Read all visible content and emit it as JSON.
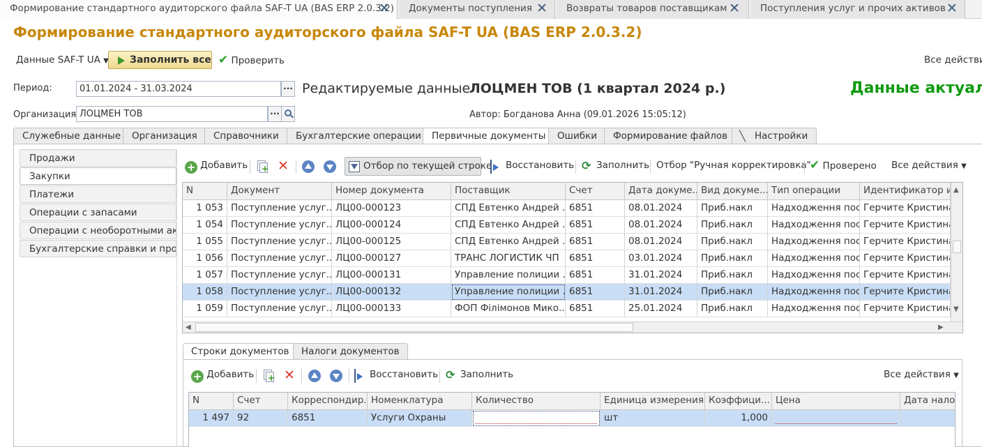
{
  "window_tabs": [
    {
      "label": "Формирование стандартного аудиторского файла SAF-T UA (BAS ERP 2.0.3.2)",
      "close": "✕"
    },
    {
      "label": "Документы поступления",
      "close": "✕"
    },
    {
      "label": "Возвраты товаров поставщикам",
      "close": "✕"
    },
    {
      "label": "Поступления услуг и прочих активов",
      "close": "✕"
    }
  ],
  "page_title": "Формирование стандартного аудиторского файла SAF-T UA (BAS ERP 2.0.3.2)",
  "command_bar": {
    "data_menu": "Данные SAF-T UA",
    "fill_all": "Заполнить все",
    "check": "Проверить",
    "all_actions": "Все действия"
  },
  "period": {
    "label": "Период:",
    "value": "01.01.2024 - 31.03.2024",
    "select": "..."
  },
  "organization": {
    "label": "Организация:",
    "value": "ЛОЦМЕН ТОВ",
    "select": "..."
  },
  "edited": {
    "label": "Редактируемые данные",
    "value": "ЛОЦМЕН ТОВ (1 квартал 2024 р.)"
  },
  "author": "Автор: Богданова Анна (09.01.2026 15:05:12)",
  "status": "Данные актуал",
  "main_tabs": [
    "Служебные данные",
    "Организация",
    "Справочники",
    "Бухгалтерские операции",
    "Первичные документы",
    "Ошибки",
    "Формирование файлов",
    "Настройки"
  ],
  "left_nav": [
    "Продажи",
    "Закупки",
    "Платежи",
    "Операции с запасами",
    "Операции с необоротными ак...",
    "Бухгалтерские справки и про..."
  ],
  "toolbar": {
    "add": "Добавить",
    "filter_current": "Отбор по текущей строке",
    "restore": "Восстановить",
    "fill": "Заполнить",
    "filter_manual": "Отбор \"Ручная корректировка\"",
    "checked": "Проверено",
    "all_actions": "Все действия"
  },
  "docs_table": {
    "columns": [
      "N",
      "Документ",
      "Номер документа",
      "Поставщик",
      "Счет",
      "Дата докуме...",
      "Вид докуме...",
      "Тип операции",
      "Идентификатор ис"
    ],
    "rows": [
      [
        "1 053",
        "Поступление услуг...",
        "ЛЦ00-000123",
        "СПД Евтенко Андрей ...",
        "6851",
        "08.01.2024",
        "Приб.накл",
        "Надходження пос...",
        "Герчите Кристина"
      ],
      [
        "1 054",
        "Поступление услуг...",
        "ЛЦ00-000124",
        "СПД Евтенко Андрей ...",
        "6851",
        "08.01.2024",
        "Приб.накл",
        "Надходження пос...",
        "Герчите Кристина"
      ],
      [
        "1 055",
        "Поступление услуг...",
        "ЛЦ00-000125",
        "СПД Евтенко Андрей ...",
        "6851",
        "08.01.2024",
        "Приб.накл",
        "Надходження пос...",
        "Герчите Кристина"
      ],
      [
        "1 056",
        "Поступление услуг...",
        "ЛЦ00-000127",
        "ТРАНС ЛОГИСТИК ЧП",
        "6851",
        "03.01.2024",
        "Приб.накл",
        "Надходження пос...",
        "Герчите Кристина"
      ],
      [
        "1 057",
        "Поступление услуг...",
        "ЛЦ00-000131",
        "Управление полиции ...",
        "6851",
        "31.01.2024",
        "Приб.накл",
        "Надходження пос...",
        "Герчите Кристина"
      ],
      [
        "1 058",
        "Поступление услуг...",
        "ЛЦ00-000132",
        "Управление полиции ...",
        "6851",
        "31.01.2024",
        "Приб.накл",
        "Надходження пос...",
        "Герчите Кристина"
      ],
      [
        "1 059",
        "Поступление услуг...",
        "ЛЦ00-000133",
        "ФОП Філімонов Мико...",
        "6851",
        "25.01.2024",
        "Приб.накл",
        "Надходження пос...",
        "Герчите Кристина"
      ]
    ],
    "selected_row": 5
  },
  "sub_tabs": [
    "Строки документов",
    "Налоги документов"
  ],
  "sub_toolbar": {
    "add": "Добавить",
    "restore": "Восстановить",
    "fill": "Заполнить",
    "all_actions": "Все действия"
  },
  "lines_table": {
    "columns": [
      "N",
      "Счет",
      "Корреспондир...",
      "Номенклатура",
      "Количество",
      "Единица измерения",
      "Коэффици...",
      "Цена",
      "Дата налог"
    ],
    "rows": [
      [
        "1 497",
        "92",
        "6851",
        "Услуги Охраны",
        "",
        "шт",
        "1,000",
        "",
        ""
      ]
    ]
  }
}
